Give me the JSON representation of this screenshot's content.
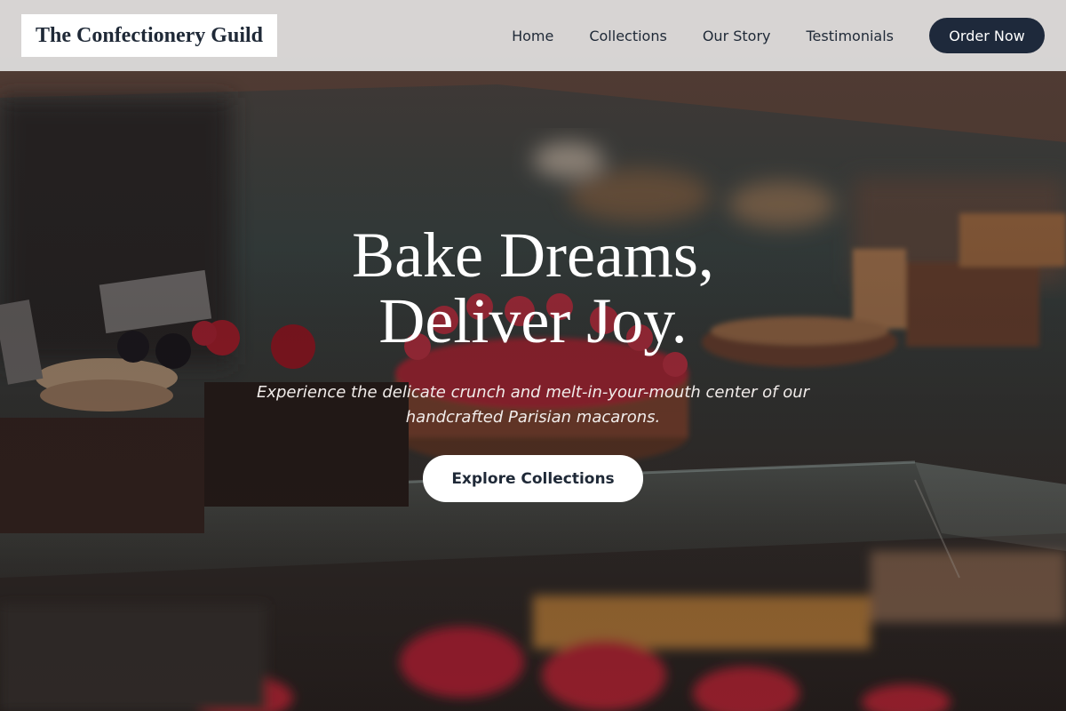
{
  "header": {
    "brand": "The Confectionery Guild",
    "nav": [
      {
        "label": "Home"
      },
      {
        "label": "Collections"
      },
      {
        "label": "Our Story"
      },
      {
        "label": "Testimonials"
      }
    ],
    "cta_label": "Order Now"
  },
  "hero": {
    "title_line1": "Bake Dreams,",
    "title_line2": "Deliver Joy.",
    "subtitle_line1": "Experience the delicate crunch and melt-in-your-mouth center of our",
    "subtitle_line2": "handcrafted Parisian macarons.",
    "cta_label": "Explore Collections"
  },
  "colors": {
    "header_bg": "#ECE9E9",
    "primary": "#1E293B",
    "text_dark": "#1F2937",
    "white": "#FFFFFF"
  }
}
